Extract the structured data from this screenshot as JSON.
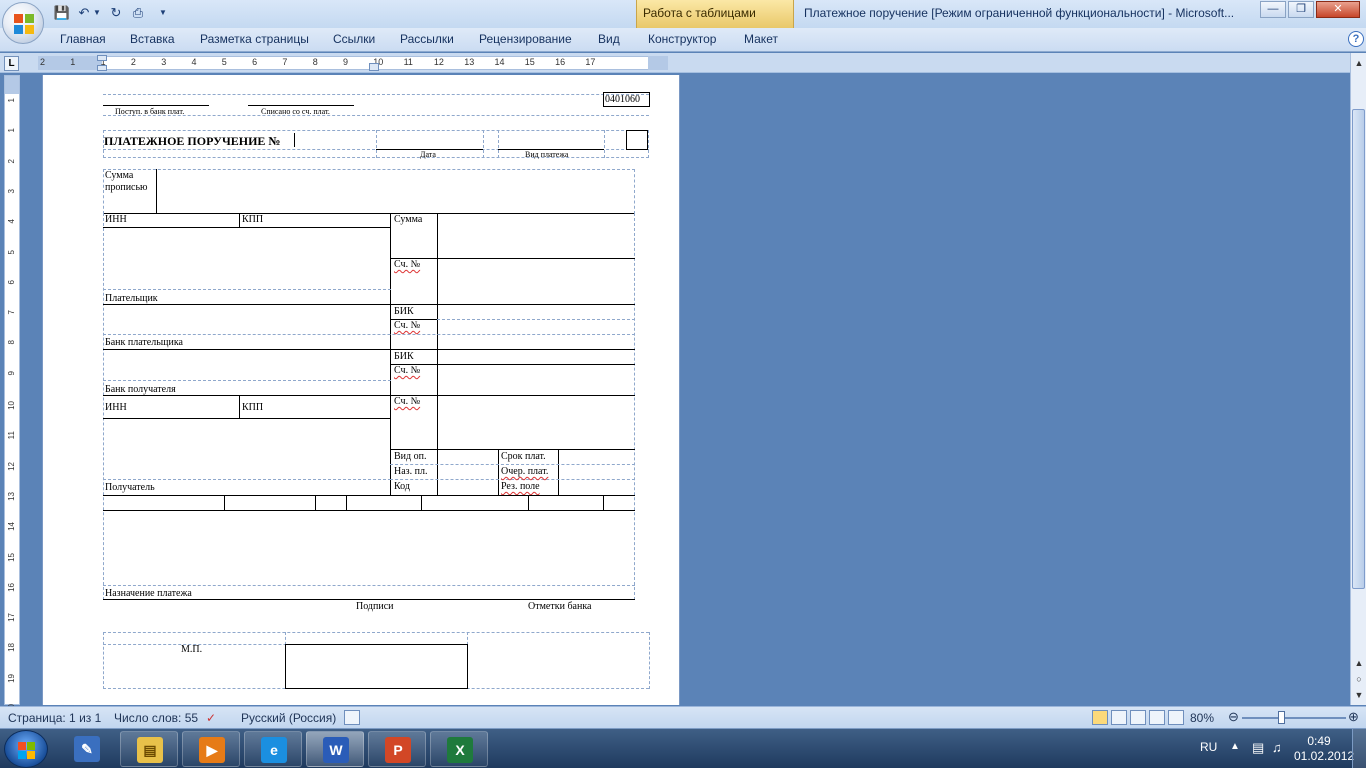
{
  "window": {
    "context_tab": "Работа с таблицами",
    "title": "Платежное поручение [Режим ограниченной функциональности] - Microsoft..."
  },
  "ribbon": {
    "tabs": [
      "Главная",
      "Вставка",
      "Разметка страницы",
      "Ссылки",
      "Рассылки",
      "Рецензирование",
      "Вид",
      "Конструктор",
      "Макет"
    ]
  },
  "ruler": {
    "h_labels": [
      "2",
      "1",
      "1",
      "2",
      "3",
      "4",
      "5",
      "6",
      "7",
      "8",
      "9",
      "10",
      "11",
      "12",
      "13",
      "14",
      "15",
      "16",
      "17"
    ],
    "v_labels": [
      "1",
      "1",
      "2",
      "3",
      "4",
      "5",
      "6",
      "7",
      "8",
      "9",
      "10",
      "11",
      "12",
      "13",
      "14",
      "15",
      "16",
      "17",
      "18",
      "19",
      "20"
    ]
  },
  "form": {
    "code": "0401060",
    "received_label": "Поступ. в банк плат.",
    "debited_label": "Списано со сч. плат.",
    "title": "ПЛАТЕЖНОЕ ПОРУЧЕНИЕ №",
    "date_label": "Дата",
    "payment_type_label": "Вид платежа",
    "sum_words_label_1": "Сумма",
    "sum_words_label_2": "прописью",
    "inn_label": "ИНН",
    "kpp_label": "КПП",
    "sum_label": "Сумма",
    "account_label": "Сч. №",
    "payer_label": "Плательщик",
    "bik_label": "БИК",
    "payer_bank_label": "Банк плательщика",
    "recipient_bank_label": "Банк получателя",
    "op_type_label": "Вид оп.",
    "pay_term_label": "Срок плат.",
    "purpose_code_label": "Наз. пл.",
    "order_label": "Очер. плат.",
    "code_label": "Код",
    "reserve_label": "Рез. поле",
    "recipient_label": "Получатель",
    "purpose_label": "Назначение платежа",
    "signatures_label": "Подписи",
    "bank_marks_label": "Отметки банка",
    "stamp_label": "М.П."
  },
  "statusbar": {
    "page": "Страница: 1 из 1",
    "words": "Число слов: 55",
    "language": "Русский (Россия)",
    "zoom": "80%"
  },
  "taskbar": {
    "lang": "RU",
    "time": "0:49",
    "date": "01.02.2012"
  }
}
